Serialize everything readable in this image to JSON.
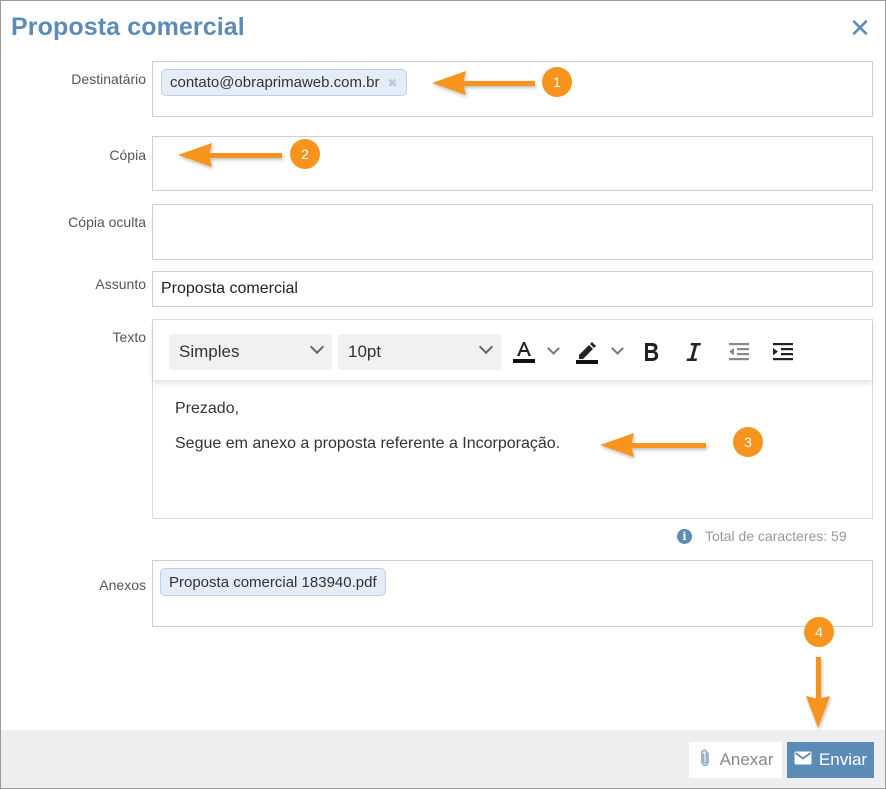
{
  "dialog": {
    "title": "Proposta comercial",
    "close_icon": "close-icon"
  },
  "form": {
    "to_label": "Destinatário",
    "to_chip": "contato@obraprimaweb.com.br",
    "to_chip_remove": "✖",
    "cc_label": "Cópia",
    "bcc_label": "Cópia oculta",
    "subject_label": "Assunto",
    "subject_value": "Proposta comercial",
    "text_label": "Texto",
    "attachments_label": "Anexos",
    "attachment_file": "Proposta comercial 183940.pdf"
  },
  "editor": {
    "font_family": "Simples",
    "font_size": "10pt",
    "line1": "Prezado,",
    "line2": "Segue em anexo a proposta referente a Incorporação."
  },
  "char_count": {
    "info_icon": "i",
    "text": "Total de caracteres: 59"
  },
  "footer": {
    "attach_label": "Anexar",
    "send_label": "Enviar"
  },
  "annotations": {
    "badge1": "1",
    "badge2": "2",
    "badge3": "3",
    "badge4": "4"
  },
  "colors": {
    "accent": "#5b8bb7",
    "annotation": "#f7941d",
    "chip_bg": "#e4ecf8"
  }
}
